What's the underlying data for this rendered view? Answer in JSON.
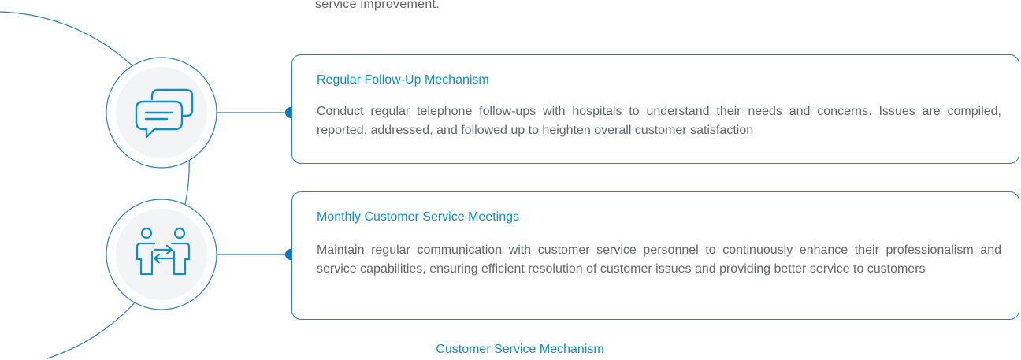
{
  "intro_tail": "service improvement.",
  "mechanisms": [
    {
      "title": "Regular Follow-Up Mechanism",
      "description": "Conduct regular telephone follow-ups with hospitals to understand their needs and concerns. Issues are compiled, reported, addressed, and followed up to heighten overall customer satisfaction",
      "icon": "chat-bubbles-icon"
    },
    {
      "title": "Monthly Customer Service Meetings",
      "description": "Maintain regular communication with customer service personnel to continuously enhance their professionalism and service capabilities, ensuring efficient resolution of customer issues and providing better service to customers",
      "icon": "people-exchange-icon"
    }
  ],
  "caption": "Customer Service Mechanism",
  "colors": {
    "accent": "#0f8fc8",
    "line": "#2f7fb0",
    "dot": "#0b78bf",
    "text": "#62676b",
    "icon_bg": "#f2f4f5"
  }
}
